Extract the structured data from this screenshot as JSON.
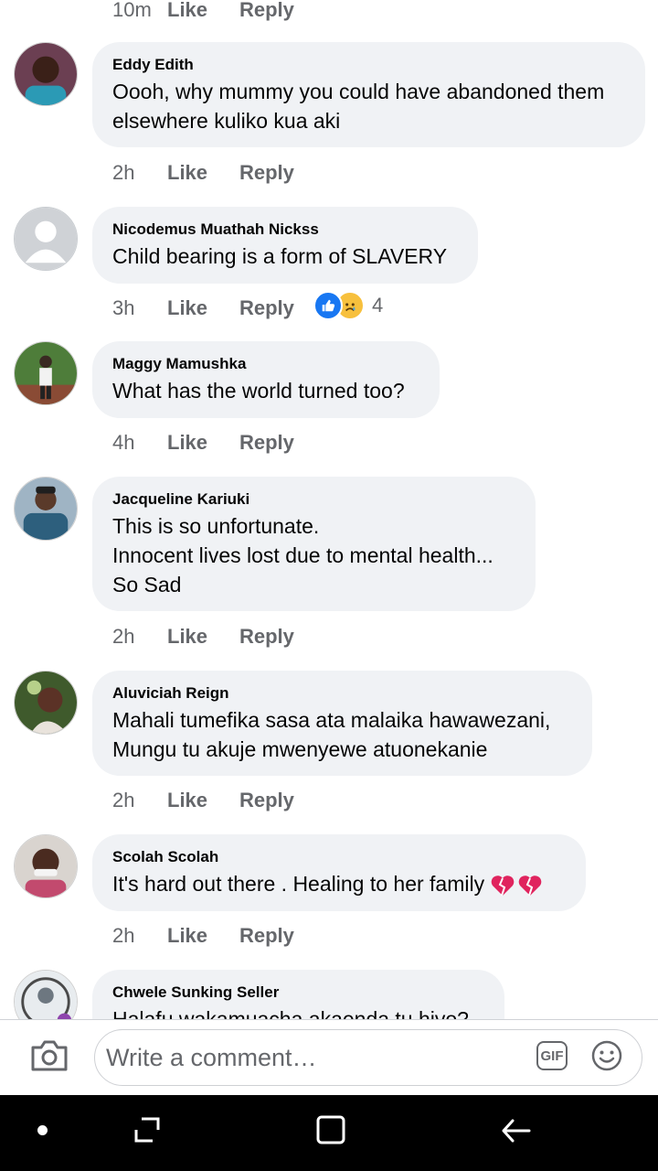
{
  "action_labels": {
    "like": "Like",
    "reply": "Reply"
  },
  "top_meta": {
    "time": "10m"
  },
  "comments": [
    {
      "author": "Eddy Edith",
      "text": "Oooh, why mummy you could have abandoned them\nelsewhere kuliko kua aki",
      "time": "2h"
    },
    {
      "author": "Nicodemus Muathah Nickss",
      "text": "Child bearing is a form of SLAVERY",
      "time": "3h",
      "reaction_count": "4",
      "reaction_icons": [
        "like-reaction-icon",
        "sad-reaction-icon"
      ]
    },
    {
      "author": "Maggy Mamushka",
      "text": "What has the world turned too?",
      "time": "4h"
    },
    {
      "author": "Jacqueline Kariuki",
      "text": "This is so unfortunate.\nInnocent lives lost due to mental health...\nSo Sad",
      "time": "2h"
    },
    {
      "author": "Aluviciah Reign",
      "text": "Mahali tumefika sasa ata malaika hawawezani,\nMungu tu akuje mwenyewe atuonekanie",
      "time": "2h"
    },
    {
      "author": "Scolah Scolah",
      "text": "It's hard out there . Healing to her family",
      "time": "2h",
      "emoji_icons": [
        "broken-heart-icon",
        "broken-heart-icon"
      ]
    },
    {
      "author": "Chwele Sunking Seller",
      "text": "Halafu wakamuacha akaenda tu hivo?"
    }
  ],
  "composer": {
    "placeholder": "Write a comment…",
    "gif_label": "GIF"
  },
  "colors": {
    "bubble": "#f0f2f5",
    "meta_text": "#65676b",
    "like_blue": "#1877f2",
    "broken_heart": "#e0245e",
    "navbar": "#000000"
  }
}
